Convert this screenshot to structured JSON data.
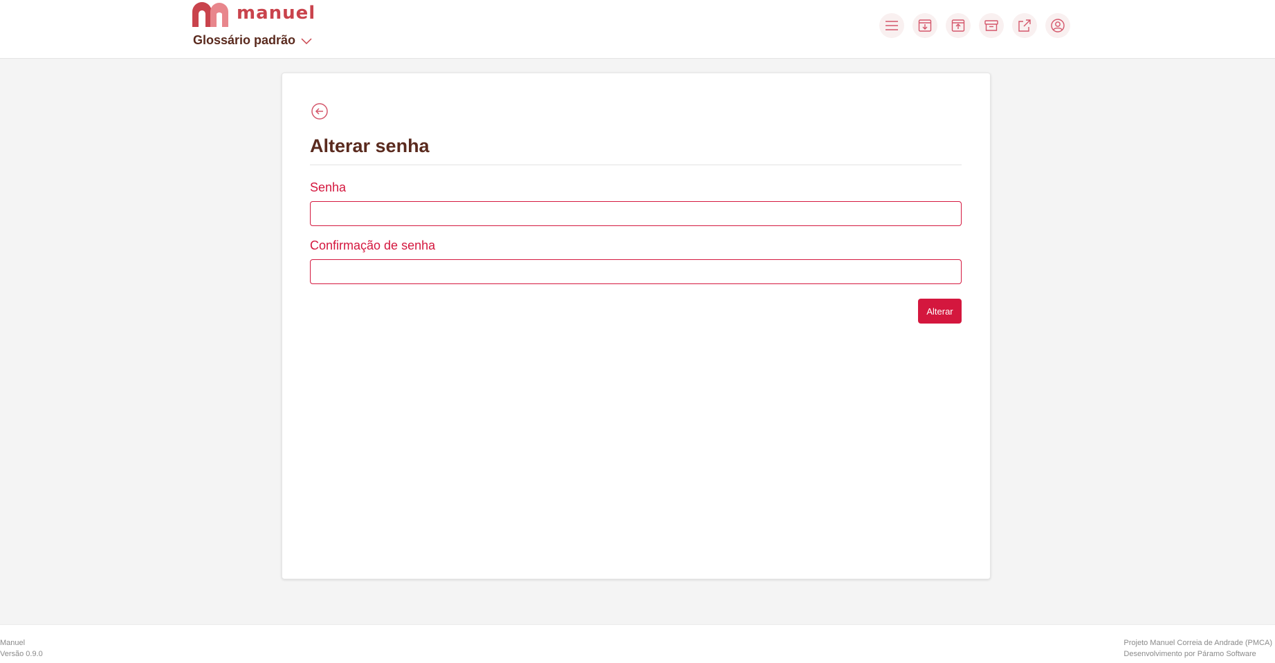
{
  "header": {
    "logo_text": "manuel",
    "glossary_label": "Glossário padrão",
    "colors": {
      "brand": "#c9434c",
      "brand_light": "#e8868c",
      "title": "#5a2a1e"
    },
    "toolbar_icons": [
      "menu-icon",
      "download-icon",
      "upload-icon",
      "archive-icon",
      "external-link-icon",
      "user-icon"
    ]
  },
  "form": {
    "title": "Alterar senha",
    "password_label": "Senha",
    "password_value": "",
    "confirm_label": "Confirmação de senha",
    "confirm_value": "",
    "submit_label": "Alterar",
    "accent_color": "#d4173e"
  },
  "footer": {
    "app_name": "Manuel",
    "version": "Versão 0.9.0",
    "project": "Projeto Manuel Correia de Andrade (PMCA)",
    "developer": "Desenvolvimento por Páramo Software"
  }
}
